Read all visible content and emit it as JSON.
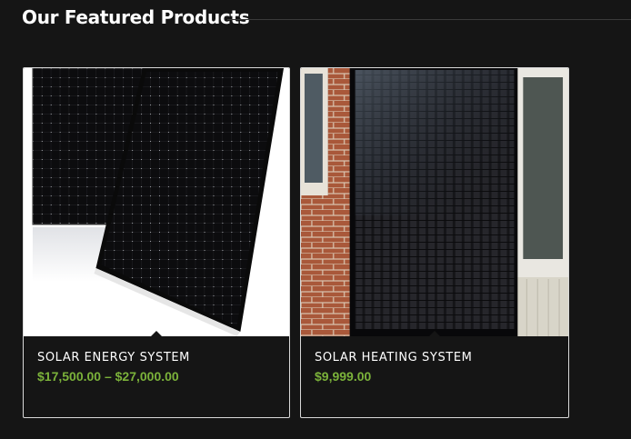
{
  "section": {
    "title": "Our Featured Products"
  },
  "products": [
    {
      "name": "SOLAR ENERGY SYSTEM",
      "price": "$17,500.00 – $27,000.00"
    },
    {
      "name": "SOLAR HEATING SYSTEM",
      "price": "$9,999.00"
    }
  ],
  "colors": {
    "background": "#151515",
    "price": "#7bb23a",
    "title": "#ffffff"
  }
}
